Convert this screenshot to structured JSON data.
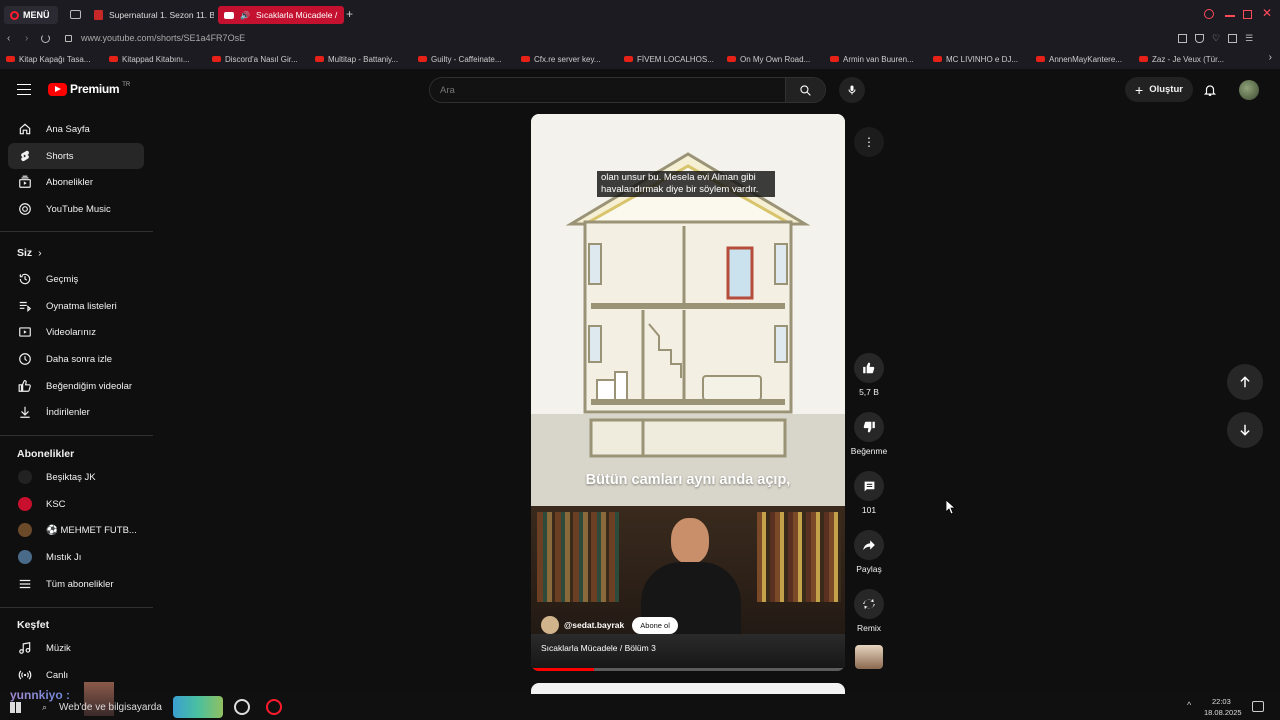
{
  "browser": {
    "menu_label": "MENÜ",
    "tabs": [
      {
        "label": "Supernatural 1. Sezon 11. B"
      },
      {
        "label": "Sıcaklarla Mücadele /"
      }
    ],
    "url": "www.youtube.com/shorts/SE1a4FR7OsE",
    "bookmarks": [
      "Kitap Kapağı Tasa...",
      "Kitappad Kitabını...",
      "Discord'a Nasıl Gir...",
      "Multitap - Battaniy...",
      "Guilty - Caffeinate...",
      "Cfx.re server key...",
      "FİVEM LOCALHOS...",
      "On My Own Road...",
      "Armin van Buuren...",
      "MC LIVINHO e DJ...",
      "AnnenMayKantere...",
      "Zaz - Je Veux (Tür..."
    ]
  },
  "header": {
    "logo_text": "Premium",
    "logo_badge": "TR",
    "search_placeholder": "Ara",
    "create_label": "Oluştur"
  },
  "sidebar": {
    "main": [
      {
        "label": "Ana Sayfa",
        "icon": "home-icon"
      },
      {
        "label": "Shorts",
        "icon": "shorts-icon"
      },
      {
        "label": "Abonelikler",
        "icon": "subscriptions-icon"
      },
      {
        "label": "YouTube Music",
        "icon": "music-icon"
      }
    ],
    "you_title": "Siz",
    "you": [
      {
        "label": "Geçmiş",
        "icon": "history-icon"
      },
      {
        "label": "Oynatma listeleri",
        "icon": "playlists-icon"
      },
      {
        "label": "Videolarınız",
        "icon": "your-videos-icon"
      },
      {
        "label": "Daha sonra izle",
        "icon": "watch-later-icon"
      },
      {
        "label": "Beğendiğim videolar",
        "icon": "liked-icon"
      },
      {
        "label": "İndirilenler",
        "icon": "downloads-icon"
      }
    ],
    "subs_title": "Abonelikler",
    "subs": [
      {
        "label": "Beşiktaş JK",
        "color": "#222"
      },
      {
        "label": "KSC",
        "color": "#c8102e"
      },
      {
        "label": "⚽ MEHMET FUTB...",
        "color": "#6b4a2a"
      },
      {
        "label": "Mıstık Jı",
        "color": "#4a6a8a"
      },
      {
        "label": "Tüm abonelikler",
        "color": ""
      }
    ],
    "explore_title": "Keşfet",
    "explore": [
      {
        "label": "Müzik",
        "icon": "music-note-icon"
      },
      {
        "label": "Canlı",
        "icon": "live-icon"
      }
    ]
  },
  "short": {
    "subtitle_top": "olan unsur bu. Mesela evi Alman gibi havalandırmak diye bir söylem vardır.",
    "caption": "Bütün camları aynı anda açıp,",
    "channel": "@sedat.bayrak",
    "subscribe_label": "Abone ol",
    "title": "Sıcaklarla Mücadele / Bölüm 3"
  },
  "actions": {
    "likes": "5,7 B",
    "dislike_label": "Beğenme",
    "comments": "101",
    "share_label": "Paylaş",
    "remix_label": "Remix"
  },
  "taskbar": {
    "user_overlay": "yunnkiyo :",
    "search_text": "Web'de ve bilgisayarda",
    "time": "22:03",
    "date": "18.08.2025"
  },
  "colors": {
    "accent": "#ff0000",
    "background": "#0f0f0f",
    "surface": "#272727"
  }
}
